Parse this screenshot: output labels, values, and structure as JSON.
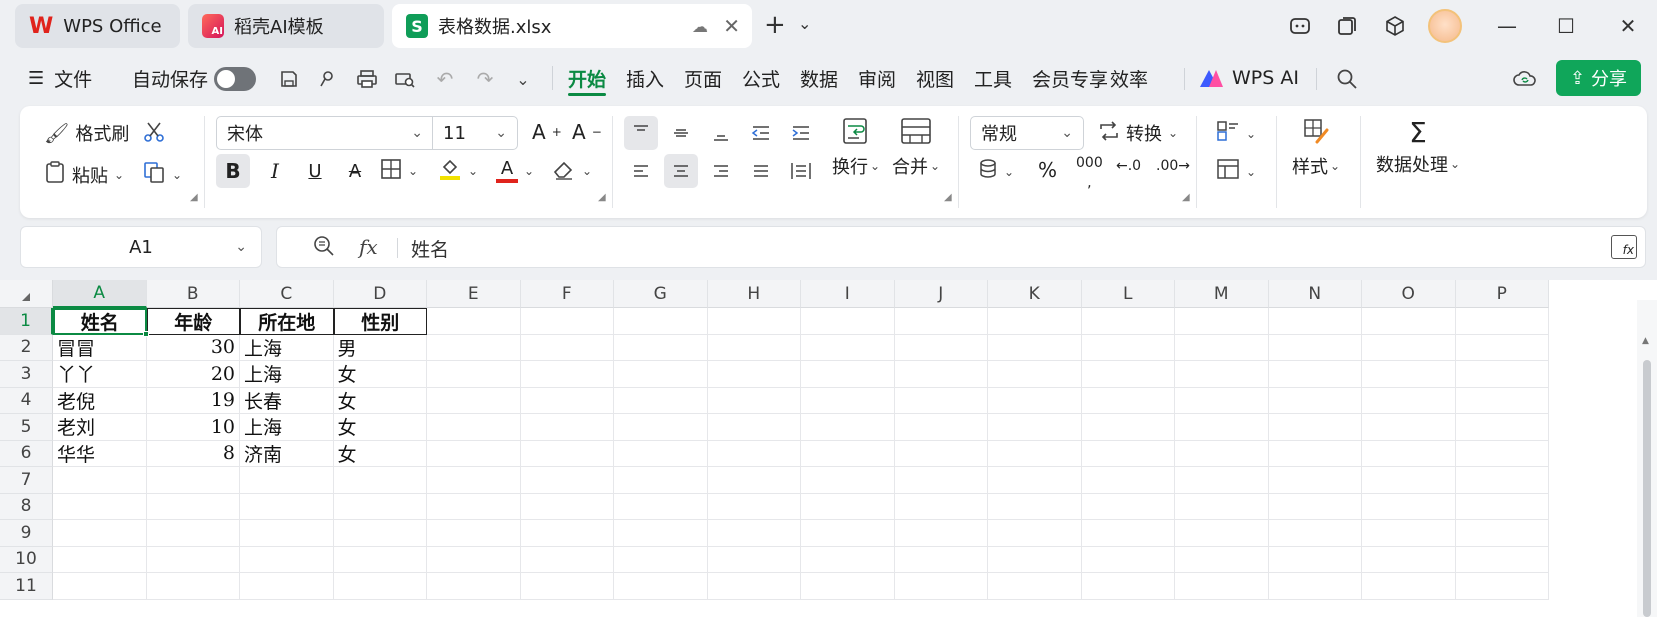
{
  "titlebar": {
    "tabs": [
      {
        "label": "WPS Office",
        "icon": "wps-logo-icon"
      },
      {
        "label": "稻壳AI模板",
        "icon": "docer-logo-icon"
      },
      {
        "label": "表格数据.xlsx",
        "icon": "spreadsheet-s-icon"
      }
    ]
  },
  "menu": {
    "file": "文件",
    "autosave": "自动保存",
    "tabs": [
      "开始",
      "插入",
      "页面",
      "公式",
      "数据",
      "审阅",
      "视图",
      "工具",
      "会员专享",
      "效率"
    ],
    "active_tab": "开始",
    "wps_ai": "WPS AI",
    "share": "分享"
  },
  "ribbon": {
    "format_painter": "格式刷",
    "paste": "粘贴",
    "font_name": "宋体",
    "font_size": "11",
    "wrap": "换行",
    "merge": "合并",
    "number_format": "常规",
    "convert": "转换",
    "style": "样式",
    "data_process": "数据处理",
    "percent": "%",
    "thousands": "000"
  },
  "formula_bar": {
    "name_box": "A1",
    "fx": "fx",
    "value": "姓名"
  },
  "sheet": {
    "columns": [
      "A",
      "B",
      "C",
      "D",
      "E",
      "F",
      "G",
      "H",
      "I",
      "J",
      "K",
      "L",
      "M",
      "N",
      "O",
      "P"
    ],
    "rows": [
      "1",
      "2",
      "3",
      "4",
      "5",
      "6",
      "7",
      "8",
      "9",
      "10",
      "11"
    ],
    "header": [
      "姓名",
      "年龄",
      "所在地",
      "性别"
    ],
    "data": [
      [
        "冒冒",
        "30",
        "上海",
        "男"
      ],
      [
        "丫丫",
        "20",
        "上海",
        "女"
      ],
      [
        "老倪",
        "19",
        "长春",
        "女"
      ],
      [
        "老刘",
        "10",
        "上海",
        "女"
      ],
      [
        "华华",
        "8",
        "济南",
        "女"
      ]
    ],
    "active_cell": "A1"
  },
  "colors": {
    "accent": "#0b8a43",
    "share_button": "#10a65a",
    "wps_red": "#e0231c"
  }
}
